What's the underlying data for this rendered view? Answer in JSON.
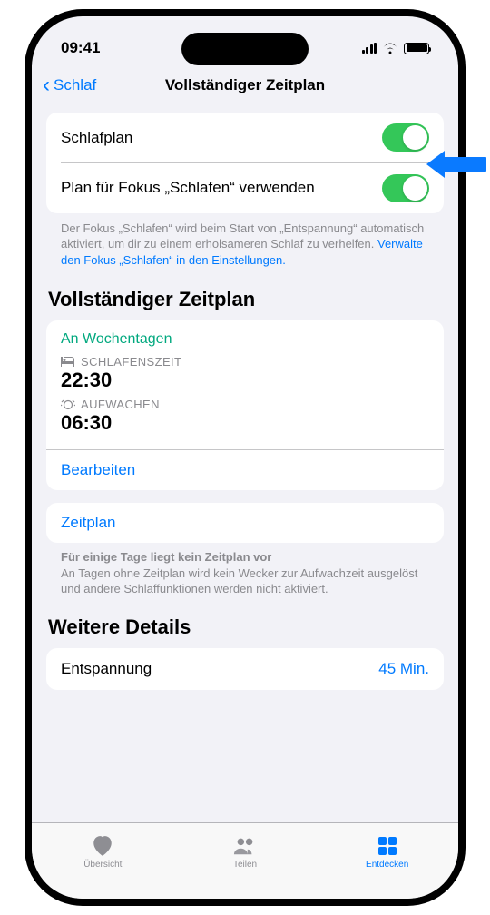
{
  "status": {
    "time": "09:41"
  },
  "nav": {
    "back": "Schlaf",
    "title": "Vollständiger Zeitplan"
  },
  "toggles": {
    "sleepPlan": {
      "label": "Schlafplan",
      "on": true
    },
    "focus": {
      "label": "Plan für Fokus „Schlafen“ verwenden",
      "on": true
    },
    "footer": "Der Fokus „Schlafen“ wird beim Start von „Entspannung“ automatisch aktiviert, um dir zu einem erholsameren Schlaf zu verhelfen. ",
    "footerLink": "Verwalte den Fokus „Schlafen“ in den Einstellungen."
  },
  "schedule": {
    "header": "Vollständiger Zeitplan",
    "days": "An Wochentagen",
    "bedtimeLabel": "SCHLAFENSZEIT",
    "bedtime": "22:30",
    "wakeLabel": "AUFWACHEN",
    "wake": "06:30",
    "edit": "Bearbeiten",
    "addPlan": "Zeitplan",
    "noteTitle": "Für einige Tage liegt kein Zeitplan vor",
    "noteBody": "An Tagen ohne Zeitplan wird kein Wecker zur Aufwachzeit ausgelöst und andere Schlaffunktionen werden nicht aktiviert."
  },
  "details": {
    "header": "Weitere Details",
    "windDown": {
      "label": "Entspannung",
      "value": "45 Min."
    }
  },
  "tabs": {
    "overview": "Übersicht",
    "share": "Teilen",
    "discover": "Entdecken"
  }
}
